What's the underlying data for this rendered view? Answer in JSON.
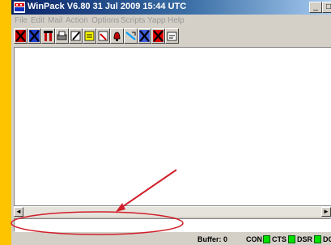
{
  "window": {
    "title": "WinPack V6.80    31 Jul 2009 15:44 UTC",
    "minimize_glyph": "_",
    "restore_glyph": "□"
  },
  "menu": [
    "File",
    "Edit",
    "Mail",
    "Action",
    "Options",
    "Scripts",
    "Yapp",
    "Help"
  ],
  "toolbar": {
    "icons": [
      "disconnect-x-icon",
      "connect-x-icon",
      "mailbox-icon",
      "printer-icon",
      "edit-pen-icon",
      "note-icon",
      "compose-icon",
      "bell-icon",
      "signal-icon",
      "cancel-x-icon",
      "abort-x-icon",
      "write-pad-icon"
    ]
  },
  "scrollbar": {
    "left_glyph": "◄",
    "right_glyph": "►"
  },
  "input_line": {
    "value": ""
  },
  "status": {
    "buffer_label": "Buffer: 0",
    "indicators": [
      {
        "name": "CON",
        "state": "on"
      },
      {
        "name": "CTS",
        "state": "on"
      },
      {
        "name": "DSR",
        "state": "on"
      },
      {
        "name": "DCD",
        "state": "on"
      }
    ]
  },
  "colors": {
    "background": "#ffc400",
    "titlebar_start": "#0a246a",
    "titlebar_end": "#a6caf0",
    "led_on": "#00e000",
    "annotation": "#d0202a"
  }
}
